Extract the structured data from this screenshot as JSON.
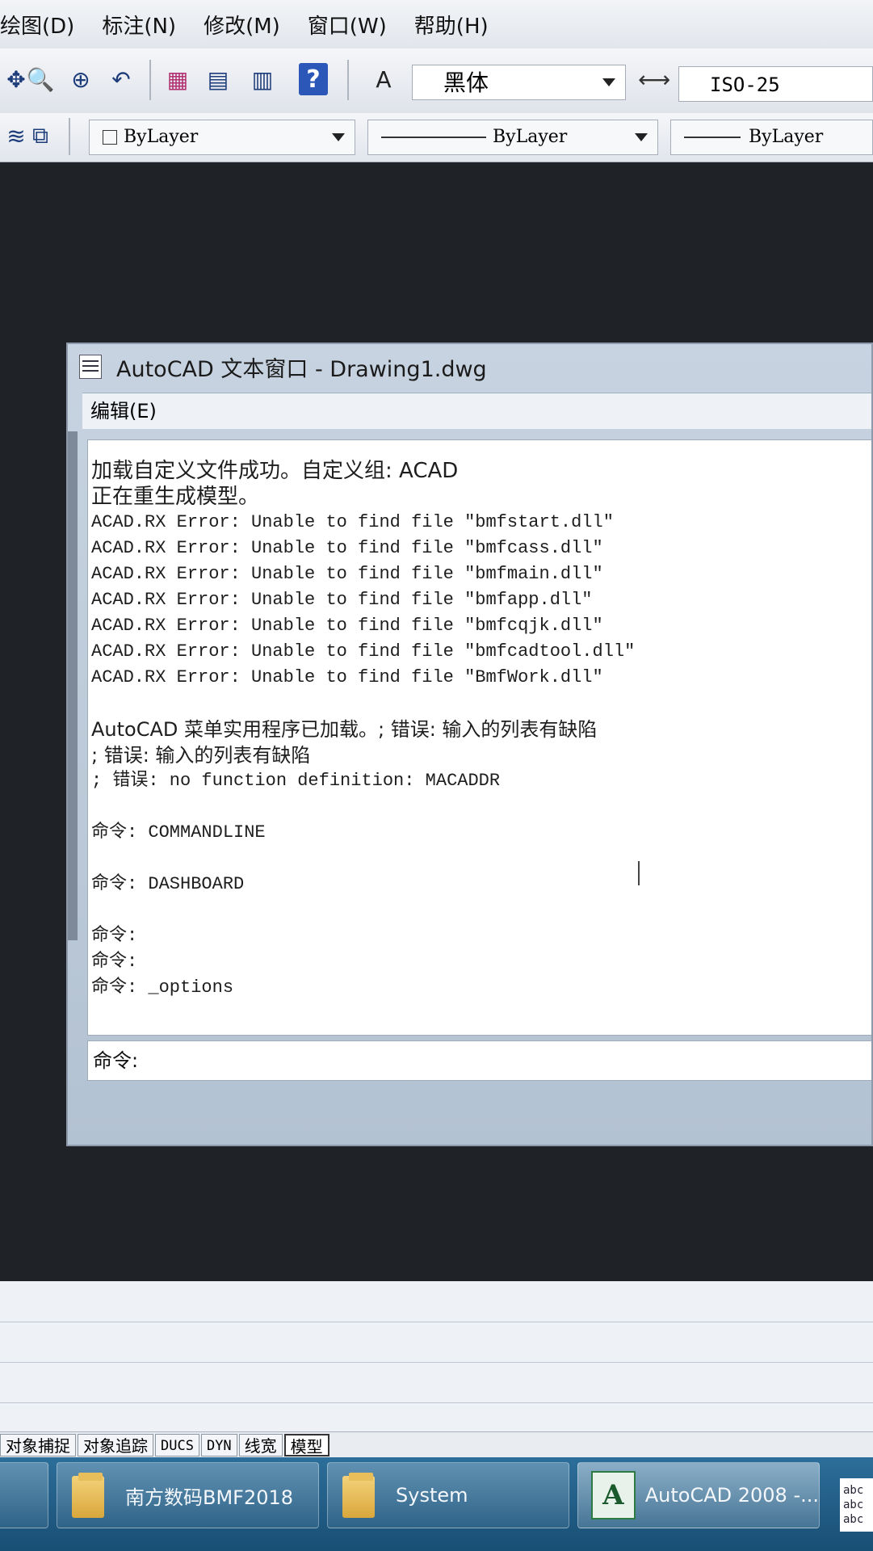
{
  "menu": {
    "items": [
      "绘图(D)",
      "标注(N)",
      "修改(M)",
      "窗口(W)",
      "帮助(H)"
    ]
  },
  "toolbar": {
    "font": "黑体",
    "dim_style": "ISO-25",
    "help_label": "?",
    "icons": [
      "pan-icon",
      "zoom-realtime-icon",
      "zoom-window-icon",
      "zoom-previous-icon",
      "properties-icon",
      "design-center-icon",
      "tool-palettes-icon",
      "help-icon",
      "text-style-icon",
      "dim-style-icon"
    ]
  },
  "layers": {
    "color": "ByLayer",
    "linetype": "ByLayer",
    "lineweight": "ByLayer"
  },
  "text_window": {
    "title": "AutoCAD 文本窗口 - Drawing1.dwg",
    "menu_edit": "编辑(E)",
    "lines": [
      "加载自定义文件成功。自定义组: ACAD",
      "正在重生成模型。",
      "ACAD.RX Error: Unable to find file \"bmfstart.dll\"",
      "ACAD.RX Error: Unable to find file \"bmfcass.dll\"",
      "ACAD.RX Error: Unable to find file \"bmfmain.dll\"",
      "ACAD.RX Error: Unable to find file \"bmfapp.dll\"",
      "ACAD.RX Error: Unable to find file \"bmfcqjk.dll\"",
      "ACAD.RX Error: Unable to find file \"bmfcadtool.dll\"",
      "ACAD.RX Error: Unable to find file \"BmfWork.dll\"",
      "",
      "AutoCAD 菜单实用程序已加载。; 错误: 输入的列表有缺陷",
      "; 错误: 输入的列表有缺陷",
      "; 错误: no function definition: MACADDR",
      "",
      "命令: COMMANDLINE",
      "",
      "命令: DASHBOARD",
      "",
      "命令:",
      "命令:",
      "命令: _options"
    ],
    "command_prompt": "命令:"
  },
  "status_bar": {
    "items": [
      "对象捕捉",
      "对象追踪",
      "DUCS",
      "DYN",
      "线宽",
      "模型"
    ]
  },
  "taskbar": {
    "tasks": [
      "南方数码BMF2018",
      "System",
      "AutoCAD 2008 -..."
    ],
    "tray_text": "abc\nabc\nabc"
  }
}
